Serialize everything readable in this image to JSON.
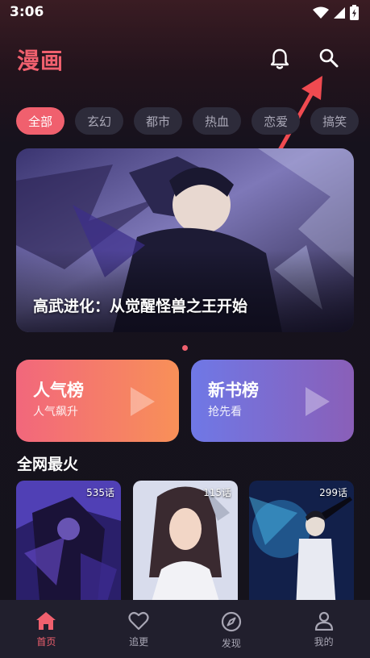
{
  "status_bar": {
    "time": "3:06"
  },
  "header": {
    "title": "漫画",
    "bell_icon": "bell-icon",
    "search_icon": "search-icon"
  },
  "categories": [
    {
      "label": "全部",
      "active": true
    },
    {
      "label": "玄幻"
    },
    {
      "label": "都市"
    },
    {
      "label": "热血"
    },
    {
      "label": "恋爱"
    },
    {
      "label": "搞笑"
    }
  ],
  "banner": {
    "title": "高武进化：从觉醒怪兽之王开始",
    "page_count": 1,
    "active_page": 1
  },
  "rank_cards": [
    {
      "title": "人气榜",
      "subtitle": "人气飙升"
    },
    {
      "title": "新书榜",
      "subtitle": "抢先看"
    }
  ],
  "section": {
    "title": "全网最火"
  },
  "comics": [
    {
      "episodes": "535话"
    },
    {
      "episodes": "115话"
    },
    {
      "episodes": "299话"
    }
  ],
  "bottom_nav": [
    {
      "label": "首页",
      "icon": "home-icon",
      "active": true
    },
    {
      "label": "追更",
      "icon": "heart-icon"
    },
    {
      "label": "发现",
      "icon": "compass-icon"
    },
    {
      "label": "我的",
      "icon": "user-icon"
    }
  ],
  "colors": {
    "accent": "#f0606e",
    "background": "#15131c",
    "chip": "#2d2b3a"
  }
}
